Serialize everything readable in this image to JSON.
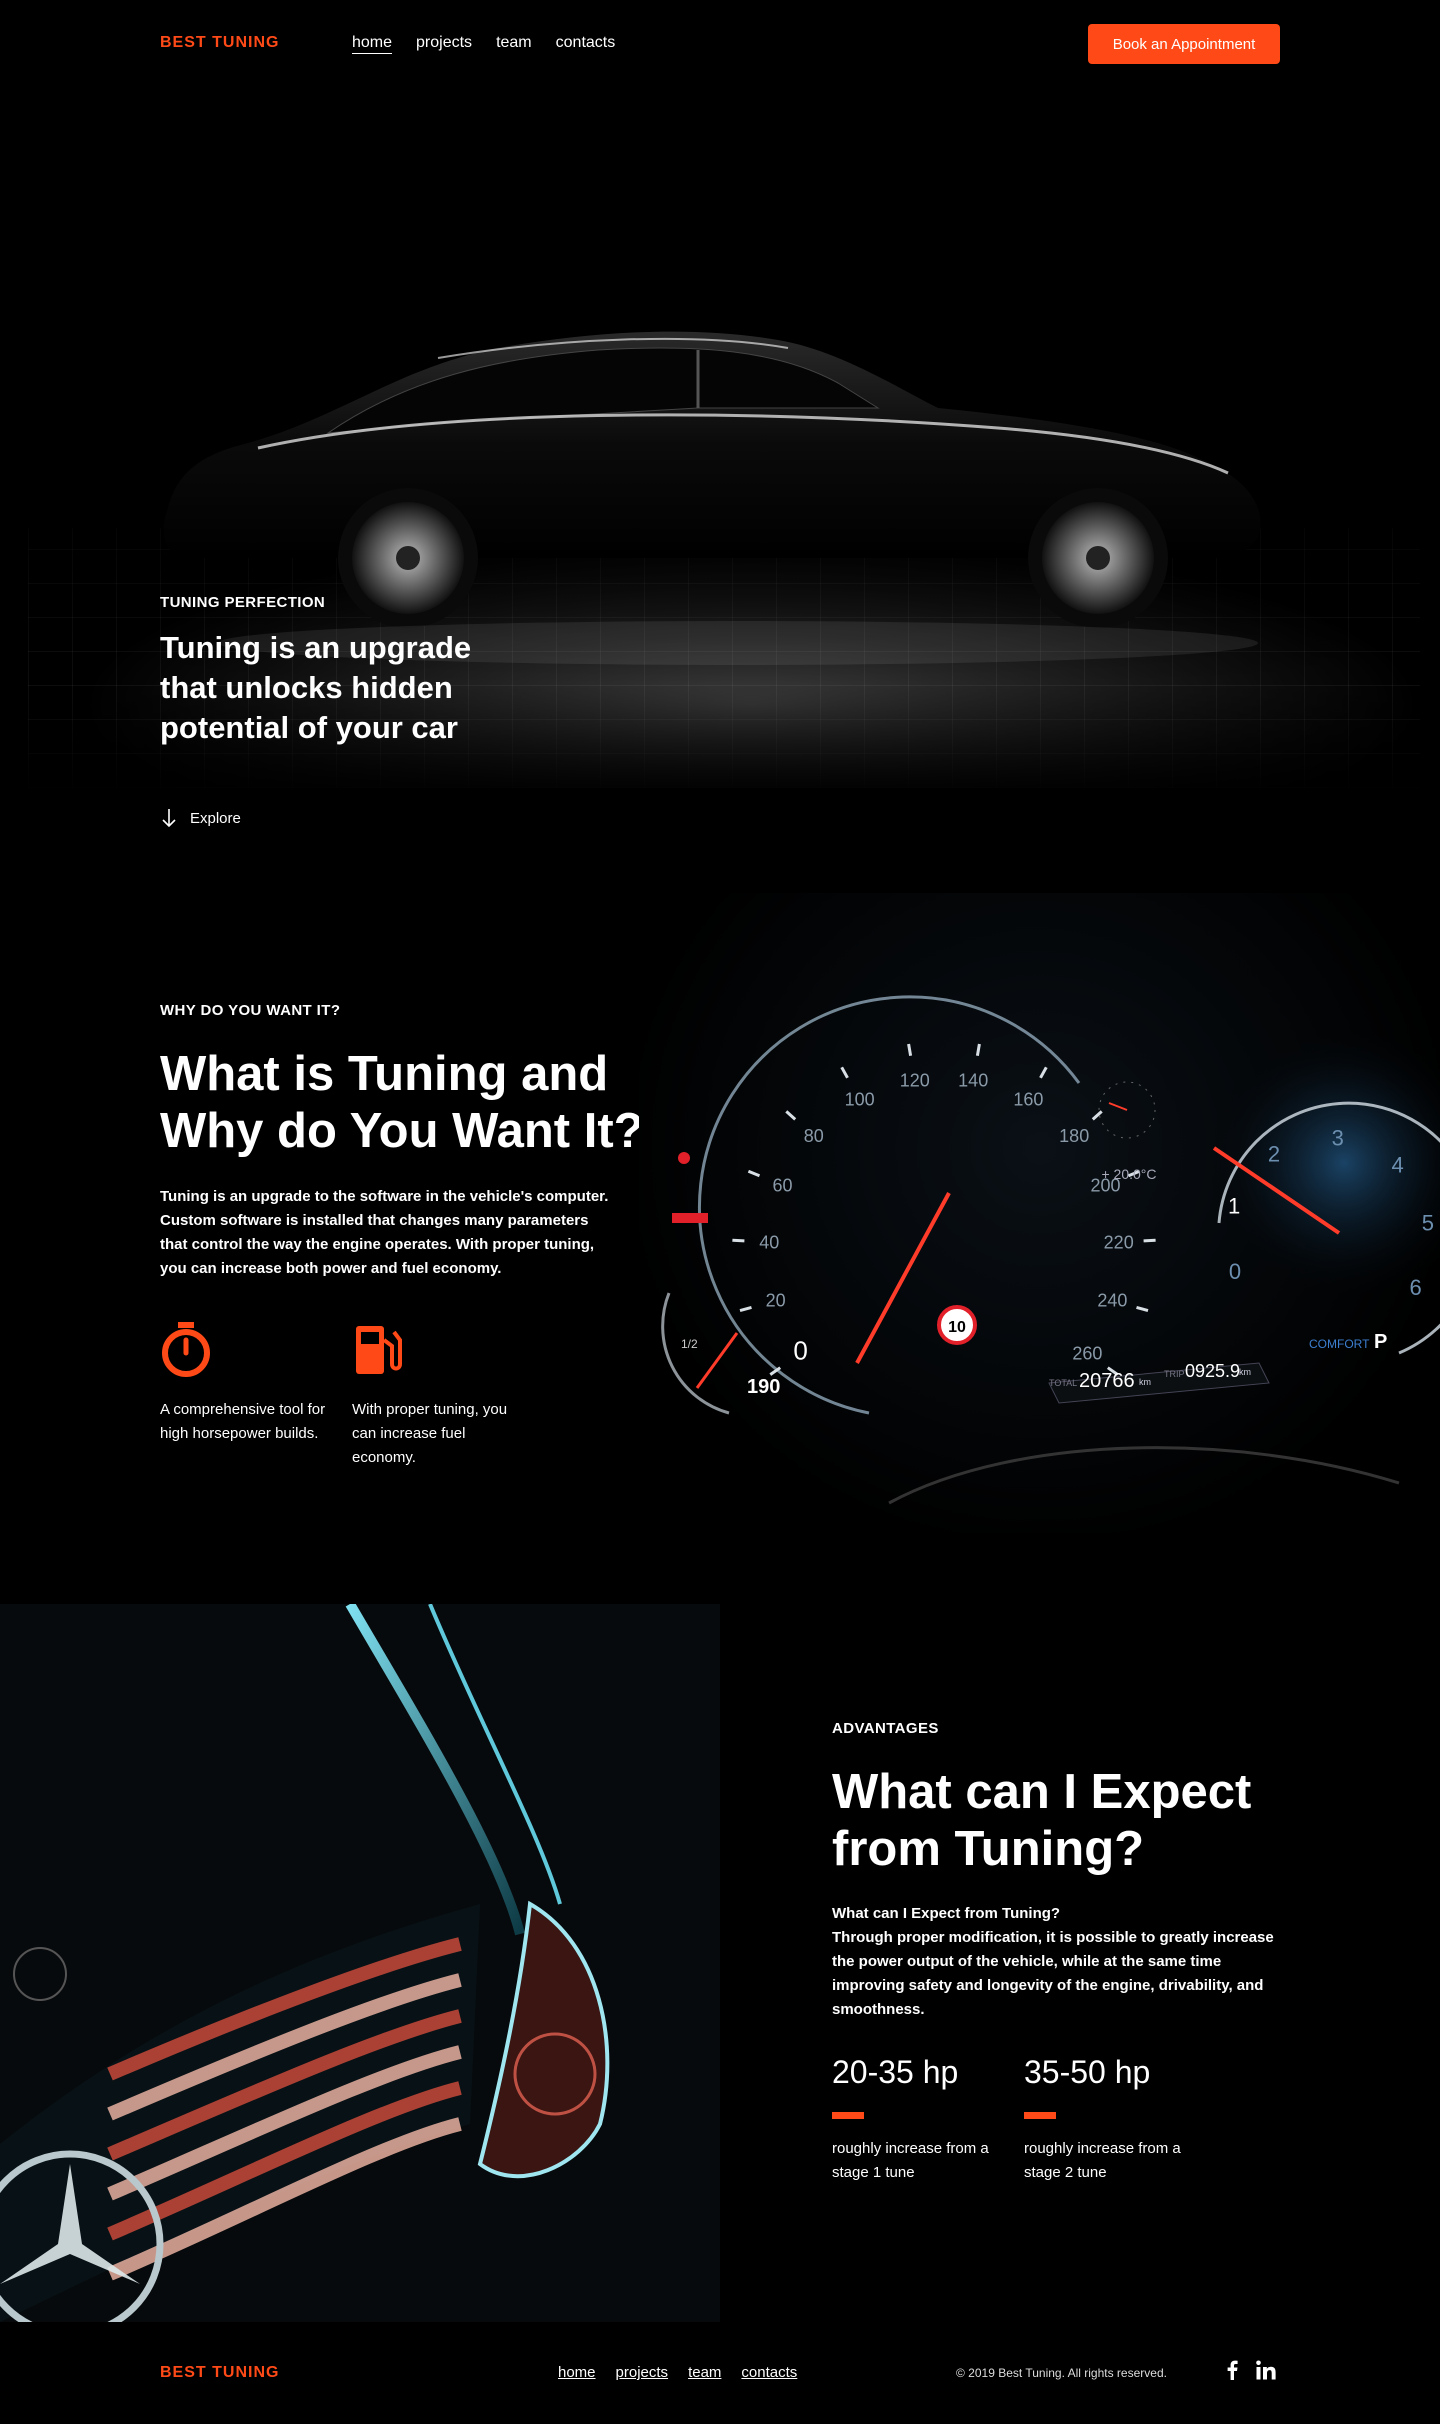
{
  "brand": {
    "name": "BEST TUNING",
    "accent": "#ff4a17"
  },
  "nav": {
    "items": [
      {
        "label": "home",
        "active": true
      },
      {
        "label": "projects",
        "active": false
      },
      {
        "label": "team",
        "active": false
      },
      {
        "label": "contacts",
        "active": false
      }
    ],
    "cta": "Book an Appointment"
  },
  "hero": {
    "eyebrow": "TUNING PERFECTION",
    "title": "Tuning is an upgrade that unlocks hidden potential of your car",
    "explore": "Explore",
    "explore_icon": "arrow-down-icon"
  },
  "why": {
    "eyebrow": "WHY DO YOU WANT IT?",
    "title": "What is Tuning and Why do You Want It?",
    "body": "Tuning is an upgrade to the software in the vehicle's computer. Custom software is installed that changes many parameters that control the way the engine operates. With proper tuning, you can increase both power and fuel economy.",
    "features": [
      {
        "icon": "stopwatch-icon",
        "text": "A comprehensive tool for high horsepower builds."
      },
      {
        "icon": "fuel-pump-icon",
        "text": "With proper tuning, you can increase fuel economy."
      }
    ],
    "dashboard": {
      "speed_ticks": [
        "0",
        "20",
        "40",
        "60",
        "80",
        "100",
        "120",
        "140",
        "160",
        "180",
        "200",
        "220",
        "240",
        "260"
      ],
      "rpm_ticks": [
        "0",
        "1",
        "2",
        "3",
        "4",
        "5",
        "6"
      ],
      "temp": "+ 20.0°C",
      "total_label": "TOTAL",
      "total": "20766",
      "total_unit": "km",
      "trip_label": "TRIP",
      "trip": "0925.9",
      "trip_unit": "km",
      "limit": "10",
      "range": "190",
      "fuel_fraction": "1/2",
      "mode": "COMFORT",
      "gear": "P"
    }
  },
  "advantages": {
    "eyebrow": "ADVANTAGES",
    "title": "What can I Expect from Tuning?",
    "subtitle": "What can I Expect from Tuning?",
    "body": "Through proper modification, it is possible to greatly increase the power output of the vehicle, while at the same time improving safety and longevity of the engine, drivability, and smoothness.",
    "stats": [
      {
        "value": "20-35 hp",
        "desc": "roughly increase from a stage 1 tune"
      },
      {
        "value": "35-50 hp",
        "desc": "roughly increase from a stage 2 tune"
      }
    ]
  },
  "footer": {
    "brand": "BEST TUNING",
    "links": [
      "home",
      "projects",
      "team",
      "contacts"
    ],
    "copyright": "© 2019 Best Tuning. All rights reserved.",
    "social": [
      "facebook-icon",
      "linkedin-icon"
    ]
  }
}
